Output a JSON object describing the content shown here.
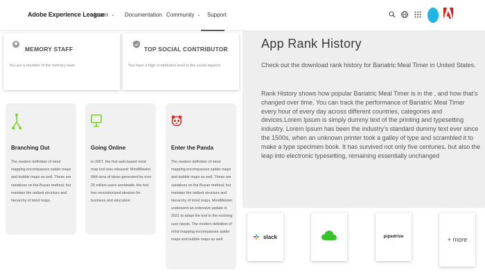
{
  "nav": {
    "brand": "Adobe Experience League",
    "items": [
      {
        "label": "Learn",
        "chevron": "⌄"
      },
      {
        "label": "Documentation",
        "chevron": ""
      },
      {
        "label": "Community",
        "chevron": "⌄"
      },
      {
        "label": "Support",
        "chevron": ""
      }
    ],
    "active": "Support",
    "icons": [
      "search-icon",
      "globe-icon",
      "apps-grid-icon",
      "avatar",
      "adobe-logo"
    ],
    "avatar_color": "#1fb5e6",
    "adobe_red": "#eb1000"
  },
  "badges": [
    {
      "icon": "memory-staff-icon",
      "title": "MEMORY STAFF",
      "desc": "You are a member of the memory team"
    },
    {
      "icon": "shield-check-icon",
      "title": "TOP SOCIAL CONTRIBUTOR",
      "desc": "You have a high contribution level to the social aspects"
    }
  ],
  "features": [
    {
      "icon": "branching-icon",
      "icon_color": "#7ed321",
      "title": "Branching Out",
      "body": "The modern definition of mind mapping encompasses spider maps and bubble maps as well. These are variations on the Buzan method, but maintain the radiant structure and hierarchy of mind maps."
    },
    {
      "icon": "monitor-icon",
      "icon_color": "#7ed321",
      "title": "Going Online",
      "body": "In 2007, the first web-based mind map tool was released: MindMeister. With tens of ideas generated by over 25 million users worldwide, the tool has revolutionized ideation for business and education."
    },
    {
      "icon": "panda-icon",
      "icon_color": "#d0342c",
      "title": "Enter the Panda",
      "body": "The modern definition of mind mapping encompasses spider maps and bubble maps as well. These are variations on the Buzan method, but maintain the radiant structure and hierarchy of mind maps. MindMeister underwent an extensive update in 2021 to adapt the tool to the evolving user needs. The modern definition of mind mapping encompasses spider maps and bubble maps as well."
    }
  ],
  "rank": {
    "title": "App Rank History",
    "intro": "Check out the download rank history for Bariatric Meal Timer in United States.",
    "body": "Rank History shows how popular Bariatric Meal Timer is in the , and how that’s changed over time. You can track the performance of Bariatric Meal Timer every hour of every day across different countries, categories and devices.Lorem Ipsum is simply dummy text of the printing and typesetting industry. Lorem Ipsum has been the industry’s standard dummy text ever since the 1500s, when an unknown printer took a galley of type and scrambled it to make a type specimen book. It has survived not only five centuries, but also the leap into electronic typesetting, remaining essentially unchanged"
  },
  "apps": [
    {
      "name": "slack",
      "icon": "slack-logo"
    },
    {
      "name": "",
      "icon": "cloud-icon",
      "color": "#37c12a"
    },
    {
      "name": "pipedrive",
      "icon": "pipedrive-logo"
    },
    {
      "name": "+ more",
      "icon": ""
    }
  ]
}
